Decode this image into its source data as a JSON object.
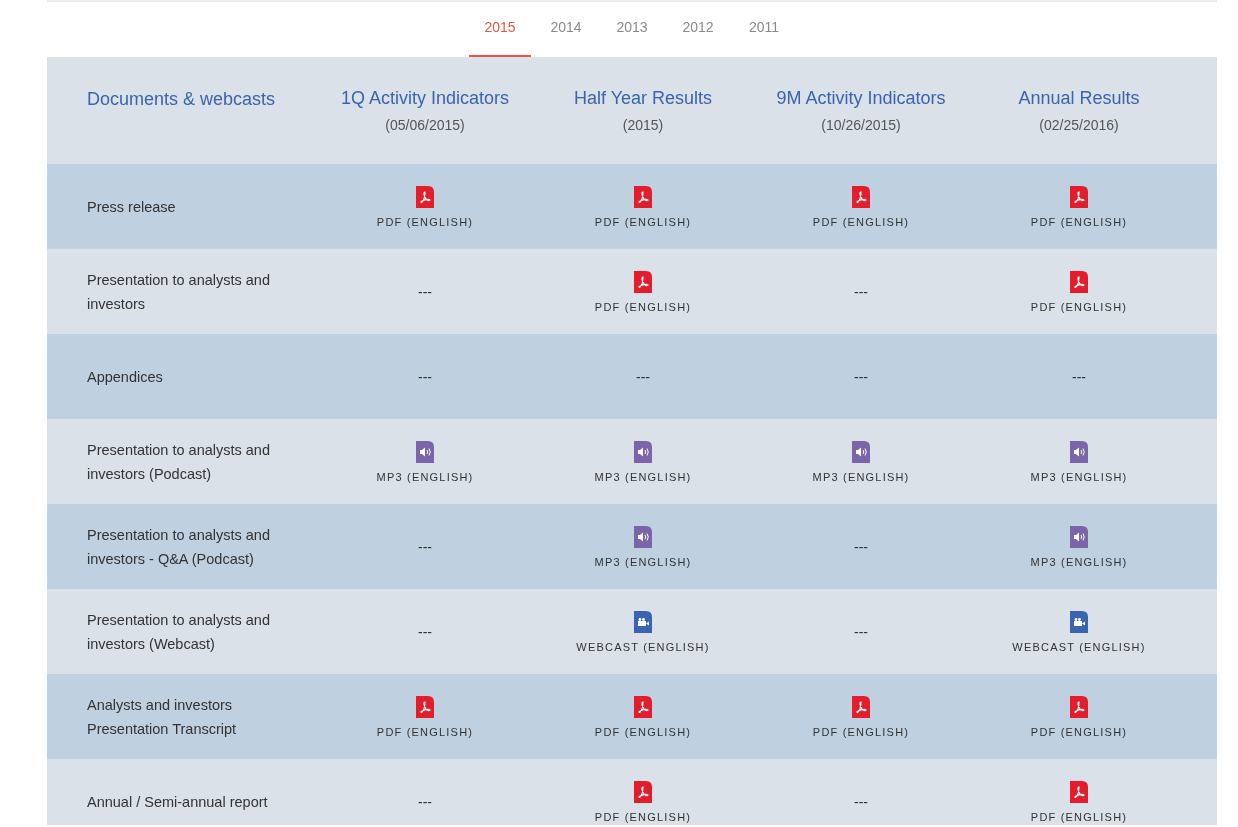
{
  "year_tabs": [
    {
      "label": "2015",
      "selected": true
    },
    {
      "label": "2014",
      "selected": false
    },
    {
      "label": "2013",
      "selected": false
    },
    {
      "label": "2012",
      "selected": false
    },
    {
      "label": "2011",
      "selected": false
    }
  ],
  "table": {
    "first_column": "Documents & webcasts",
    "columns": [
      {
        "title": "1Q Activity Indicators",
        "date": "(05/06/2015)"
      },
      {
        "title": "Half Year Results",
        "date": "(2015)"
      },
      {
        "title": "9M Activity Indicators",
        "date": "(10/26/2015)"
      },
      {
        "title": "Annual Results",
        "date": "(02/25/2016)"
      }
    ],
    "rows": [
      {
        "label": "Press release",
        "cells": [
          {
            "kind": "pdf",
            "text": "PDF (ENGLISH)"
          },
          {
            "kind": "pdf",
            "text": "PDF (ENGLISH)"
          },
          {
            "kind": "pdf",
            "text": "PDF (ENGLISH)"
          },
          {
            "kind": "pdf",
            "text": "PDF (ENGLISH)"
          }
        ]
      },
      {
        "label": "Presentation to analysts and investors",
        "cells": [
          {
            "kind": "none",
            "text": "---"
          },
          {
            "kind": "pdf",
            "text": "PDF (ENGLISH)"
          },
          {
            "kind": "none",
            "text": "---"
          },
          {
            "kind": "pdf",
            "text": "PDF (ENGLISH)"
          }
        ]
      },
      {
        "label": "Appendices",
        "cells": [
          {
            "kind": "none",
            "text": "---"
          },
          {
            "kind": "none",
            "text": "---"
          },
          {
            "kind": "none",
            "text": "---"
          },
          {
            "kind": "none",
            "text": "---"
          }
        ]
      },
      {
        "label": "Presentation to analysts and investors (Podcast)",
        "cells": [
          {
            "kind": "mp3",
            "text": "MP3 (ENGLISH)"
          },
          {
            "kind": "mp3",
            "text": "MP3 (ENGLISH)"
          },
          {
            "kind": "mp3",
            "text": "MP3 (ENGLISH)"
          },
          {
            "kind": "mp3",
            "text": "MP3 (ENGLISH)"
          }
        ]
      },
      {
        "label": "Presentation to analysts and investors - Q&A (Podcast)",
        "cells": [
          {
            "kind": "none",
            "text": "---"
          },
          {
            "kind": "mp3",
            "text": "MP3 (ENGLISH)"
          },
          {
            "kind": "none",
            "text": "---"
          },
          {
            "kind": "mp3",
            "text": "MP3 (ENGLISH)"
          }
        ]
      },
      {
        "label": "Presentation to analysts and investors (Webcast)",
        "cells": [
          {
            "kind": "none",
            "text": "---"
          },
          {
            "kind": "webcast",
            "text": "WEBCAST (ENGLISH)"
          },
          {
            "kind": "none",
            "text": "---"
          },
          {
            "kind": "webcast",
            "text": "WEBCAST (ENGLISH)"
          }
        ]
      },
      {
        "label": "Analysts and investors Presentation Transcript",
        "cells": [
          {
            "kind": "pdf",
            "text": "PDF (ENGLISH)"
          },
          {
            "kind": "pdf",
            "text": "PDF (ENGLISH)"
          },
          {
            "kind": "pdf",
            "text": "PDF (ENGLISH)"
          },
          {
            "kind": "pdf",
            "text": "PDF (ENGLISH)"
          }
        ]
      },
      {
        "label": "Annual / Semi-annual report",
        "cells": [
          {
            "kind": "none",
            "text": "---"
          },
          {
            "kind": "pdf",
            "text": "PDF (ENGLISH)"
          },
          {
            "kind": "none",
            "text": "---"
          },
          {
            "kind": "pdf",
            "text": "PDF (ENGLISH)"
          }
        ]
      }
    ]
  }
}
